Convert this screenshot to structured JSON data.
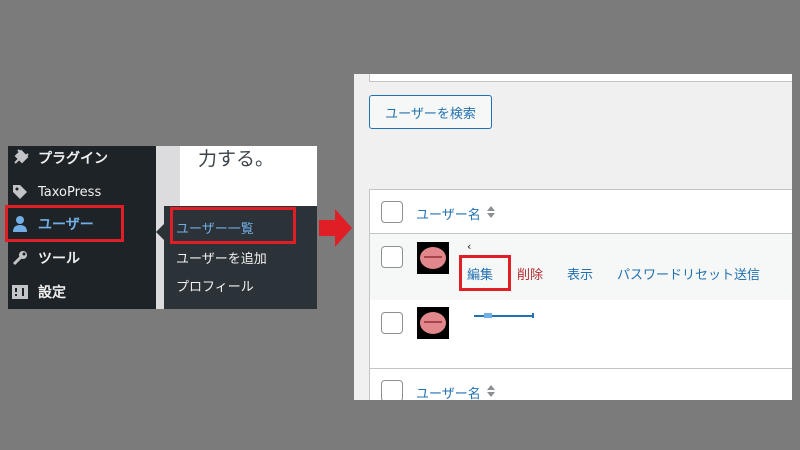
{
  "sidebar": {
    "items": [
      {
        "label": "プラグイン",
        "icon": "plugin-icon"
      },
      {
        "label": "TaxoPress",
        "icon": "tag-icon"
      },
      {
        "label": "ユーザー",
        "icon": "user-icon"
      },
      {
        "label": "ツール",
        "icon": "wrench-icon"
      },
      {
        "label": "設定",
        "icon": "settings-icon"
      }
    ]
  },
  "submenu": {
    "items": [
      {
        "label": "ユーザー一覧"
      },
      {
        "label": "ユーザーを追加"
      },
      {
        "label": "プロフィール"
      }
    ]
  },
  "content": {
    "text": "力する。"
  },
  "users_page": {
    "search_button": "ユーザーを検索",
    "column_username": "ユーザー名",
    "rows": [
      {
        "name_fragment": "‹",
        "actions": {
          "edit": "編集",
          "delete": "削除",
          "view": "表示",
          "reset": "パスワードリセット送信"
        }
      }
    ]
  },
  "colors": {
    "highlight": "#e01e26",
    "admin_bg": "#1d2327",
    "link": "#2271b1",
    "danger": "#b32d2e"
  }
}
